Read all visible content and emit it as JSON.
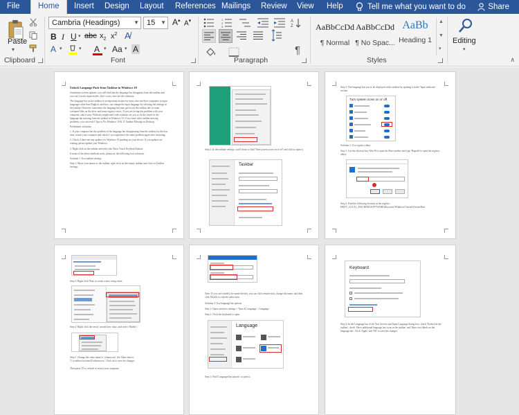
{
  "tabs": [
    "File",
    "Home",
    "Insert",
    "Design",
    "Layout",
    "References",
    "Mailings",
    "Review",
    "View",
    "Help"
  ],
  "active_tab": "Home",
  "tell_me": "Tell me what you want to do",
  "share": "Share",
  "clipboard": {
    "paste": "Paste",
    "label": "Clipboard"
  },
  "font": {
    "name": "Cambria (Headings)",
    "size": "15",
    "label": "Font"
  },
  "paragraph": {
    "label": "Paragraph"
  },
  "styles": {
    "label": "Styles",
    "items": [
      {
        "sample": "AaBbCcDd",
        "name": "¶ Normal"
      },
      {
        "sample": "AaBbCcDd",
        "name": "¶ No Spac..."
      },
      {
        "sample": "AaBb",
        "name": "Heading 1"
      }
    ],
    "heading_color": "#2e74b5"
  },
  "editing": {
    "label": "Editing"
  },
  "colors": {
    "ribbon_blue": "#2b579a",
    "highlight": "#ffff00",
    "font_color": "#e00000",
    "accent_red": "#d32f2f",
    "accent_blue": "#1e6fc9"
  },
  "pages": {
    "p1": {
      "title": "Unlock Language Pack from Taskbar in Windows 10",
      "paragraphs": [
        "Sometimes system updates, you will find that the language bar disappears from the taskbar and you can't switch input modes, don't worry, here are the solutions.",
        "The language bar on the taskbar is an important feature for users who use their computers to input languages other than English, and thus, can change the input language by selecting the settings in the taskbar. However, sometimes the language bar may get lost in the taskbar due to some corrupted files on the drive and some registry errors. If you are facing this problem with your computer, take it easy. Without complicated code solutions for you to fix the issues or the language bar missing from the taskbar in Windows 10. If you have other taskbar missing problems, you can read 5 Tips to Fix Windows 10 & 11 Taskbar Missing on Desktop.",
        "Preliminary solutions",
        "1. If your computer has the problem of the language bar disappearing from the taskbar for the first time, restart your computer and check if you experience the same problem again after restarting.",
        "2. Check if there are any updates for Windows 10 pending on your device. If you updates are waiting, please update your Windows.",
        "3. Right click on the taskbar and select the Show Touch Keyboard button.",
        "If none of the above methods work, please try the following four solutions.",
        "Solution 1: Use taskbar settings",
        "Step 1: Move your mouse to the taskbar, right click on the empty, taskbar and click on Taskbar Settings."
      ]
    },
    "p2": {
      "caption1": "Step 2: In the taskbar settings, scroll down to find 'Turn system icons on or off' and click to open it.",
      "shot_title": "Taskbar"
    },
    "p3": {
      "caption1": "Step 3: The language bar you to be displayed in the taskbar by opening it in the 'Input indicator' section.",
      "shot_title": "Turn system icons on or off",
      "caption2": "Solution 2: Use registry editor",
      "caption3": "Step 1: Use the shortcut key Win+R to open the Run window and type 'Regedit' to open the registry editor.",
      "caption4": "Step 2: Find the following location in the registry: HKEY_LOCAL_MACHINE\\SOFTWARE\\Microsoft\\Windows\\CurrentVersion\\Run"
    },
    "p4": {
      "caption1": "Step 3: Right click 'Run' to create a new string value.",
      "caption2": "Step 4: Right click the newly created key value, and select 'Modify'.",
      "caption3": "Step 5: Change the value name to 'ctfmon.exe', the Value data to 'C:\\windows\\system32\\ctfmon.exe'. Click ok to save the changes.",
      "caption4": "Then press F5 to refresh or restart your computer."
    },
    "p5": {
      "caption1": "Note: If you can't modify the name directly, you can click rename first, change the name, and then click Modify to edit the value data.",
      "caption2": "Solution 3: Use language bar options",
      "caption3": "Step 1: Open windows settings > Time & Language > Language",
      "caption4": "Step 2: Click the keyboard to open.",
      "shot_title": "Language",
      "caption5": "Step 3: Find 'Language bar options' to open it."
    },
    "p6": {
      "shot_title": "Keyboard",
      "caption1": "Step 4: In the Language bar of the Text Service and Input Language dialog box, check 'Docked in the taskbar', check 'Show additional language bar icons in the taskbar' and 'Show text labels on the language bar'. Click 'Apply' and 'OK' to save the changes."
    }
  }
}
